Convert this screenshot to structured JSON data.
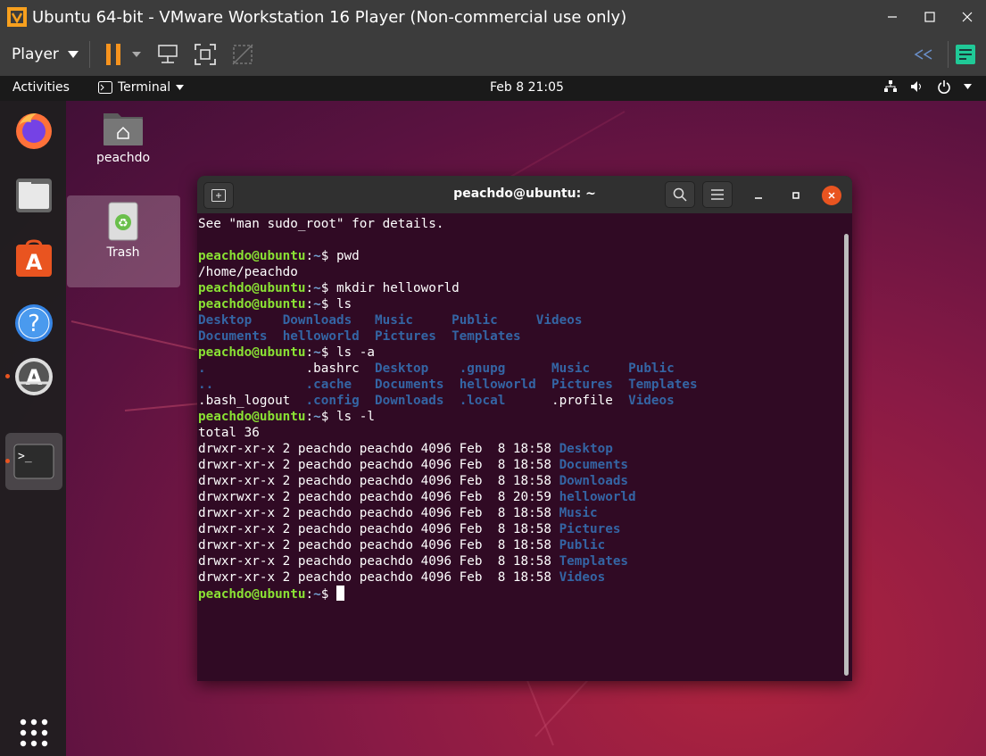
{
  "vm": {
    "title": "Ubuntu 64-bit - VMware Workstation 16 Player (Non-commercial use only)",
    "player_menu": "Player",
    "accent": "#f7931e"
  },
  "gnome": {
    "activities": "Activities",
    "app_menu": "Terminal",
    "clock": "Feb 8  21:05"
  },
  "dock": {
    "items": [
      "firefox-icon",
      "files-icon",
      "software-icon",
      "help-icon",
      "updater-icon",
      "terminal-icon",
      "show-apps-icon"
    ]
  },
  "desktop": {
    "home_label": "peachdo",
    "trash_label": "Trash"
  },
  "terminal": {
    "title": "peachdo@ubuntu: ~",
    "prompt_user": "peachdo@ubuntu",
    "prompt_path": "~",
    "lines": {
      "intro": "See \"man sudo_root\" for details.",
      "cmd_pwd": " pwd",
      "out_pwd": "/home/peachdo",
      "cmd_mkdir": " mkdir helloworld",
      "cmd_ls": " ls",
      "cmd_lsa": " ls -a",
      "cmd_lsl": " ls -l",
      "total": "total 36"
    },
    "ls_rows": [
      [
        "Desktop",
        "Downloads",
        "Music",
        "Public",
        "Videos"
      ],
      [
        "Documents",
        "helloworld",
        "Pictures",
        "Templates"
      ]
    ],
    "lsa_rows": [
      [
        ".",
        ".bashrc",
        "Desktop",
        ".gnupg",
        "Music",
        "Public"
      ],
      [
        "..",
        ".cache",
        "Documents",
        "helloworld",
        "Pictures",
        "Templates"
      ],
      [
        ".bash_logout",
        ".config",
        "Downloads",
        ".local",
        ".profile",
        "Videos"
      ]
    ],
    "lsl": [
      {
        "perm": "drwxr-xr-x",
        "meta": " 2 peachdo peachdo 4096 Feb  8 18:58 ",
        "name": "Desktop"
      },
      {
        "perm": "drwxr-xr-x",
        "meta": " 2 peachdo peachdo 4096 Feb  8 18:58 ",
        "name": "Documents"
      },
      {
        "perm": "drwxr-xr-x",
        "meta": " 2 peachdo peachdo 4096 Feb  8 18:58 ",
        "name": "Downloads"
      },
      {
        "perm": "drwxrwxr-x",
        "meta": " 2 peachdo peachdo 4096 Feb  8 20:59 ",
        "name": "helloworld"
      },
      {
        "perm": "drwxr-xr-x",
        "meta": " 2 peachdo peachdo 4096 Feb  8 18:58 ",
        "name": "Music"
      },
      {
        "perm": "drwxr-xr-x",
        "meta": " 2 peachdo peachdo 4096 Feb  8 18:58 ",
        "name": "Pictures"
      },
      {
        "perm": "drwxr-xr-x",
        "meta": " 2 peachdo peachdo 4096 Feb  8 18:58 ",
        "name": "Public"
      },
      {
        "perm": "drwxr-xr-x",
        "meta": " 2 peachdo peachdo 4096 Feb  8 18:58 ",
        "name": "Templates"
      },
      {
        "perm": "drwxr-xr-x",
        "meta": " 2 peachdo peachdo 4096 Feb  8 18:58 ",
        "name": "Videos"
      }
    ]
  }
}
